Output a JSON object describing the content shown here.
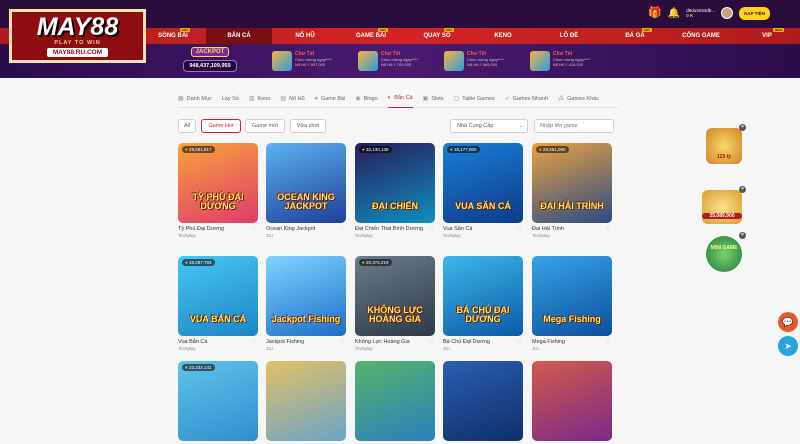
{
  "brand": {
    "logo": "MAY88",
    "tagline": "PLAY TO WIN",
    "domain": "MAY88.RU.COM"
  },
  "header": {
    "username": "d9du3n53db...",
    "balance": "0 K",
    "deposit_label": "NẠP TIỀN"
  },
  "nav": [
    {
      "label": "SÒNG BÀI",
      "badge": "HOT"
    },
    {
      "label": "BẮN CÁ",
      "badge": ""
    },
    {
      "label": "NỔ HŨ",
      "badge": ""
    },
    {
      "label": "GAME BÀI",
      "badge": "HOT"
    },
    {
      "label": "QUAY SỐ",
      "badge": "HOT"
    },
    {
      "label": "KENO",
      "badge": ""
    },
    {
      "label": "LÔ ĐỀ",
      "badge": ""
    },
    {
      "label": "ĐÁ GÀ",
      "badge": "HOT"
    },
    {
      "label": "CỔNG GAME",
      "badge": ""
    },
    {
      "label": "VIP",
      "badge": "NEW"
    }
  ],
  "promo": {
    "jackpot_title": "JACKPOT",
    "jackpot_value": "948,437,109,959",
    "winners": [
      {
        "title": "Chư Tết",
        "sub": "Chúc mừng ngay****",
        "amount": "Nổ Hũ  ₫ 907,000"
      },
      {
        "title": "Chư Tết",
        "sub": "Chúc mừng ngay****",
        "amount": "Nổ Hũ  ₫ 700,000"
      },
      {
        "title": "Chư Tết",
        "sub": "Chúc mừng ngay****",
        "amount": "Nổ Hũ  ₫ 565,000"
      },
      {
        "title": "Chư Tết",
        "sub": "Chúc mừng ngay****",
        "amount": "Nổ Hũ  ₫ 418,000"
      }
    ]
  },
  "tabs": [
    {
      "label": "Danh Mục",
      "icon": "grid-icon",
      "active": false
    },
    {
      "label": "Lay Số",
      "icon": "dice-icon",
      "active": false
    },
    {
      "label": "Keno",
      "icon": "keno-icon",
      "active": false
    },
    {
      "label": "Nổ Hũ",
      "icon": "slot-icon",
      "active": false
    },
    {
      "label": "Game Bài",
      "icon": "cards-icon",
      "active": false
    },
    {
      "label": "Bingo",
      "icon": "bingo-icon",
      "active": false
    },
    {
      "label": "Bắn Cá",
      "icon": "fish-icon",
      "active": true
    },
    {
      "label": "Slots",
      "icon": "slots-icon",
      "active": false
    },
    {
      "label": "Table Games",
      "icon": "table-icon",
      "active": false
    },
    {
      "label": "Games Nhanh",
      "icon": "rocket-icon",
      "active": false
    },
    {
      "label": "Games Khác",
      "icon": "more-icon",
      "active": false
    }
  ],
  "filters": {
    "buttons": [
      "All",
      "Game Hot",
      "Game mới",
      "Vừa chơi"
    ],
    "active_index": 1,
    "provider_placeholder": "Nhà Cung Cấp",
    "search_placeholder": "Nhập tên game"
  },
  "games": [
    {
      "name": "Tỷ Phú Đại Dương",
      "provider": "Techplay",
      "counter": "29,591,817",
      "thumb_text": "TỶ PHÚ ĐẠI DƯƠNG",
      "c1": "#f7a33b",
      "c2": "#e03a6c"
    },
    {
      "name": "Ocean King Jackpot",
      "provider": "JILI",
      "counter": "",
      "thumb_text": "OCEAN KING JACKPOT",
      "c1": "#5db3f0",
      "c2": "#1d3f9a"
    },
    {
      "name": "Đại Chiến Thái Bình Dương",
      "provider": "Techplay",
      "counter": "32,130,138",
      "thumb_text": "ĐẠI CHIẾN",
      "c1": "#2a1c5a",
      "c2": "#0e8fbf"
    },
    {
      "name": "Vua Săn Cá",
      "provider": "Techplay",
      "counter": "18,177,800",
      "thumb_text": "VUA SĂN CÁ",
      "c1": "#1a7fd6",
      "c2": "#0e3a8a"
    },
    {
      "name": "Đại Hải Trình",
      "provider": "Techplay",
      "counter": "29,551,060",
      "thumb_text": "ĐẠI HẢI TRÌNH",
      "c1": "#e8a142",
      "c2": "#2a4b86"
    },
    {
      "name": "Vua Bắn Cá",
      "provider": "Techplay",
      "counter": "18,297,793",
      "thumb_text": "VUA BẮN CÁ",
      "c1": "#49c6f0",
      "c2": "#1a86c8"
    },
    {
      "name": "Jackpot Fishing",
      "provider": "JILI",
      "counter": "",
      "thumb_text": "Jackpot Fishing",
      "c1": "#7fd4ff",
      "c2": "#1d6ec8"
    },
    {
      "name": "Không Lực Hoàng Gia",
      "provider": "Techplay",
      "counter": "20,374,219",
      "thumb_text": "KHÔNG LỰC HOÀNG GIA",
      "c1": "#6b7c8a",
      "c2": "#2d3a48"
    },
    {
      "name": "Bá Chủ Đại Dương",
      "provider": "JILI",
      "counter": "",
      "thumb_text": "BÁ CHỦ ĐẠI DƯƠNG",
      "c1": "#3db7e8",
      "c2": "#0a5aa8"
    },
    {
      "name": "Mega Fishing",
      "provider": "JILI",
      "counter": "",
      "thumb_text": "Mega Fishing",
      "c1": "#37a3e6",
      "c2": "#0d4f9e"
    },
    {
      "name": "",
      "provider": "",
      "counter": "22,232,141",
      "thumb_text": "",
      "c1": "#5ec3e8",
      "c2": "#2f8fcf"
    },
    {
      "name": "",
      "provider": "",
      "counter": "",
      "thumb_text": "",
      "c1": "#e3c066",
      "c2": "#6aa4c8"
    },
    {
      "name": "",
      "provider": "",
      "counter": "",
      "thumb_text": "",
      "c1": "#55b46a",
      "c2": "#2a7fbe"
    },
    {
      "name": "",
      "provider": "",
      "counter": "",
      "thumb_text": "",
      "c1": "#2a5fb0",
      "c2": "#0f2f6a"
    },
    {
      "name": "",
      "provider": "",
      "counter": "",
      "thumb_text": "",
      "c1": "#d05a4a",
      "c2": "#7a2a8a"
    }
  ],
  "side_promos": [
    {
      "text": "125 tỷ"
    },
    {
      "text": "25,089,900"
    },
    {
      "text": "MINI GAME"
    }
  ],
  "floating": [
    {
      "icon": "chat-icon",
      "color": "#e85a2a"
    },
    {
      "icon": "telegram-icon",
      "color": "#2aa3e0"
    }
  ]
}
